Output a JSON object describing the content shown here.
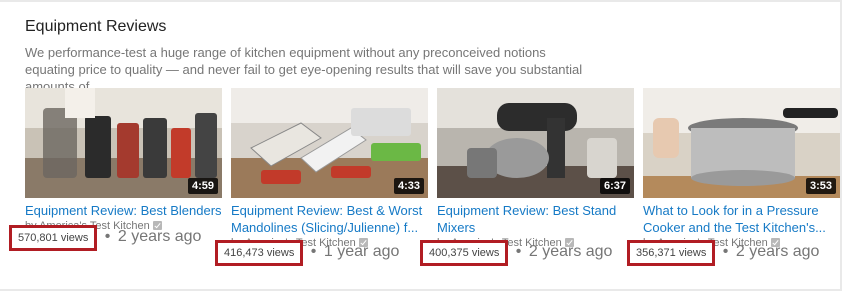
{
  "section": {
    "title": "Equipment Reviews",
    "description": "We performance-test a huge range of kitchen equipment without any preconceived notions equating price to quality — and never fail to get eye-opening results that will save you substantial amounts of..."
  },
  "videos": [
    {
      "title": "Equipment Review: Best Blenders",
      "channel": "by America's Test Kitchen",
      "duration": "4:59",
      "views": "570,801 views",
      "age": "2 years ago",
      "thumb_icon": "blenders-thumbnail"
    },
    {
      "title": "Equipment Review: Best & Worst Mandolines (Slicing/Julienne) f...",
      "channel": "by America's Test Kitchen",
      "duration": "4:33",
      "views": "416,473 views",
      "age": "1 year ago",
      "thumb_icon": "mandolines-thumbnail"
    },
    {
      "title": "Equipment Review: Best Stand Mixers",
      "channel": "by America's Test Kitchen",
      "duration": "6:37",
      "views": "400,375 views",
      "age": "2 years ago",
      "thumb_icon": "stand-mixer-thumbnail"
    },
    {
      "title": "What to Look for in a Pressure Cooker and the Test Kitchen's...",
      "channel": "by America's Test Kitchen",
      "duration": "3:53",
      "views": "356,371 views",
      "age": "2 years ago",
      "thumb_icon": "pressure-cooker-thumbnail"
    }
  ],
  "colors": {
    "link": "#167ac6",
    "highlight_border": "#b11d23"
  }
}
